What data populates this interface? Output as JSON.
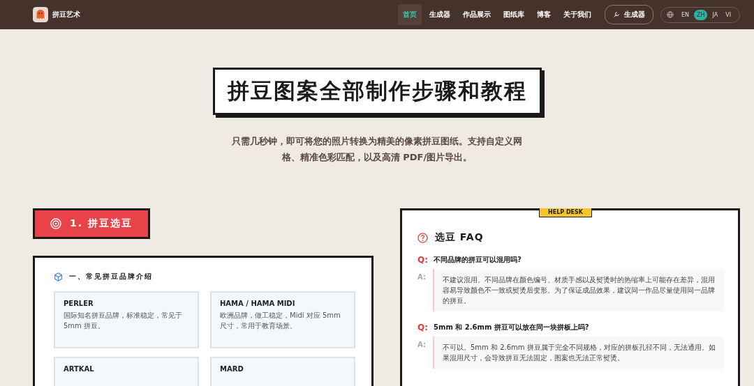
{
  "nav": {
    "logo_text": "拼豆艺术",
    "links": [
      {
        "label": "首页",
        "selected": true
      },
      {
        "label": "生成器",
        "selected": false
      },
      {
        "label": "作品展示",
        "selected": false
      },
      {
        "label": "图纸库",
        "selected": false
      },
      {
        "label": "博客",
        "selected": false
      },
      {
        "label": "关于我们",
        "selected": false
      }
    ],
    "generator_button": "生成器",
    "languages": [
      {
        "label": "EN",
        "selected": false
      },
      {
        "label": "ZH",
        "selected": true
      },
      {
        "label": "JA",
        "selected": false
      },
      {
        "label": "VI",
        "selected": false
      }
    ]
  },
  "hero": {
    "title": "拼豆图案全部制作步骤和教程",
    "subtitle": "只需几秒钟，即可将您的照片转换为精美的像素拼豆图纸。支持自定义网格、精准色彩匹配，以及高清 PDF/图片导出。"
  },
  "section": {
    "title": "1. 拼豆选豆"
  },
  "brands": {
    "heading": "一、常见拼豆品牌介绍",
    "items": [
      {
        "name": "PERLER",
        "description": "国际知名拼豆品牌，标准稳定，常见于 5mm 拼豆。"
      },
      {
        "name": "HAMA / HAMA MIDI",
        "description": "欧洲品牌，做工稳定，Midi 对应 5mm 尺寸，常用于教育场景。"
      },
      {
        "name": "ARTKAL"
      },
      {
        "name": "MARD"
      }
    ]
  },
  "faq": {
    "tag": "HELP DESK",
    "title": "选豆 FAQ",
    "items": [
      {
        "q_label": "Q:",
        "question": "不同品牌的拼豆可以混用吗?",
        "a_label": "A:",
        "answer": "不建议混用。不同品牌在颜色编号、材质手感以及熨烫时的热缩率上可能存在差异，混用容易导致颜色不一致或熨烫后变形。为了保证成品效果，建议同一作品尽量使用同一品牌的拼豆。"
      },
      {
        "q_label": "Q:",
        "question": "5mm 和 2.6mm 拼豆可以放在同一块拼板上吗?",
        "a_label": "A:",
        "answer": "不可以。5mm 和 2.6mm 拼豆属于完全不同规格，对应的拼板孔径不同，无法通用。如果混用尺寸，会导致拼豆无法固定，图案也无法正常熨烫。"
      }
    ]
  }
}
